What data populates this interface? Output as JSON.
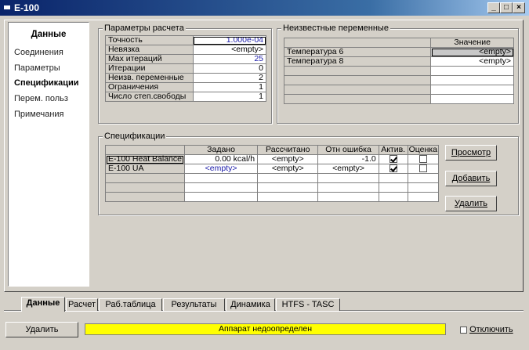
{
  "window": {
    "title": "E-100"
  },
  "nav": {
    "header": "Данные",
    "items": [
      {
        "label": "Соединения",
        "selected": false
      },
      {
        "label": "Параметры",
        "selected": false
      },
      {
        "label": "Спецификации",
        "selected": true
      },
      {
        "label": "Перем. польз",
        "selected": false
      },
      {
        "label": "Примечания",
        "selected": false
      }
    ]
  },
  "params": {
    "title": "Параметры расчета",
    "rows": [
      {
        "label": "Точность",
        "value": "1.000e-04"
      },
      {
        "label": "Невязка",
        "value": "<empty>"
      },
      {
        "label": "Max итераций",
        "value": "25"
      },
      {
        "label": "Итерации",
        "value": "0"
      },
      {
        "label": "Неизв. переменные",
        "value": "2"
      },
      {
        "label": "Ограничения",
        "value": "1"
      },
      {
        "label": "Число степ.свободы",
        "value": "1"
      }
    ]
  },
  "unknowns": {
    "title": "Неизвестные переменные",
    "col_value": "Значение",
    "rows": [
      {
        "name": "Температура 6",
        "value": "<empty>"
      },
      {
        "name": "Температура 8",
        "value": "<empty>"
      }
    ]
  },
  "specs": {
    "title": "Спецификации",
    "columns": [
      "Задано",
      "Рассчитано",
      "Отн ошибка",
      "Актив.",
      "Оценка"
    ],
    "rows": [
      {
        "name": "E-100 Heat Balance",
        "specified": "0.00 kcal/h",
        "calculated": "<empty>",
        "error": "-1.0",
        "active": true,
        "estimate": false
      },
      {
        "name": "E-100 UA",
        "specified": "<empty>",
        "calculated": "<empty>",
        "error": "<empty>",
        "active": true,
        "estimate": false
      }
    ],
    "buttons": {
      "view": "Просмотр",
      "add": "Добавить",
      "delete": "Удалить"
    }
  },
  "tabs": [
    {
      "label": "Данные",
      "active": true
    },
    {
      "label": "Расчет",
      "active": false
    },
    {
      "label": "Раб.таблица",
      "active": false
    },
    {
      "label": "Результаты",
      "active": false
    },
    {
      "label": "Динамика",
      "active": false
    },
    {
      "label": "HTFS - TASC",
      "active": false
    }
  ],
  "footer": {
    "delete_button": "Удалить",
    "status": "Аппарат недоопределен",
    "disable_label": "Отключить"
  },
  "colors": {
    "titlebar": "#0a246a",
    "status_bg": "#ffff00",
    "blue_value": "#1a1aa8"
  }
}
